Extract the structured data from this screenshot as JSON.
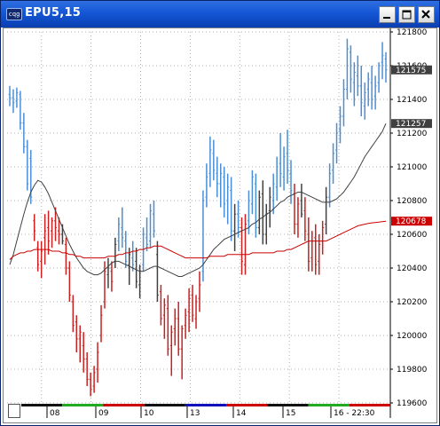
{
  "window": {
    "title": "EPU5,15",
    "app_icon_text": "cqg"
  },
  "chart_data": {
    "type": "bar",
    "subtype": "ohlc",
    "symbol": "EPU5",
    "interval_minutes": 15,
    "ylim": [
      119600,
      121800
    ],
    "y_tick_labels": [
      "121800",
      "121600",
      "121400",
      "121200",
      "121000",
      "120800",
      "120600",
      "120400",
      "120200",
      "120000",
      "119800",
      "119600"
    ],
    "x_tick_labels": [
      "08",
      "09",
      "10",
      "13",
      "14",
      "15",
      "16 - 22:30"
    ],
    "price_tags": [
      {
        "label": "121575",
        "value": 121575,
        "color": "#404040",
        "series": "last price"
      },
      {
        "label": "121257",
        "value": 121257,
        "color": "#404040",
        "series": "short moving average"
      },
      {
        "label": "120678",
        "value": 120678,
        "color": "#cc0000",
        "series": "long moving average"
      }
    ],
    "colors": {
      "up_trend": "#4a8fd6",
      "down_trend": "#cc2020",
      "neutral": "#404040",
      "short_ma": "#404040",
      "long_ma": "#cc0000"
    },
    "grid": true,
    "grid_style": "dotted",
    "session_bar_colors": [
      "#111111",
      "#22aa22",
      "#cc0000",
      "#111111",
      "#1111bb",
      "#cc0000",
      "#111111",
      "#22aa22",
      "#cc0000"
    ],
    "series": [
      {
        "name": "",
        "kind": "ohlc",
        "bars": [
          [
            121430,
            121480,
            121360,
            121410
          ],
          [
            121410,
            121460,
            121320,
            121380
          ],
          [
            121390,
            121470,
            121350,
            121440
          ],
          [
            121430,
            121450,
            121220,
            121260
          ],
          [
            121260,
            121320,
            121080,
            121120
          ],
          [
            121120,
            121160,
            120860,
            120900
          ],
          [
            121050,
            121100,
            120780,
            120820
          ],
          [
            120680,
            120720,
            120560,
            120620
          ],
          [
            120520,
            120560,
            120380,
            120420
          ],
          [
            120440,
            120560,
            120340,
            120500
          ],
          [
            120580,
            120720,
            120420,
            120620
          ],
          [
            120640,
            120740,
            120480,
            120560
          ],
          [
            120620,
            120700,
            120520,
            120680
          ],
          [
            120680,
            120760,
            120560,
            120640
          ],
          [
            120620,
            120700,
            120540,
            120600
          ],
          [
            120600,
            120660,
            120540,
            120560
          ],
          [
            120540,
            120580,
            120360,
            120400
          ],
          [
            120400,
            120440,
            120200,
            120240
          ],
          [
            120200,
            120240,
            120020,
            120060
          ],
          [
            120080,
            120120,
            119900,
            119980
          ],
          [
            119980,
            120060,
            119840,
            120020
          ],
          [
            119940,
            120020,
            119780,
            119860
          ],
          [
            119860,
            119900,
            119700,
            119740
          ],
          [
            119740,
            119780,
            119640,
            119680
          ],
          [
            119700,
            119820,
            119660,
            119780
          ],
          [
            119800,
            119960,
            119720,
            119900
          ],
          [
            120000,
            120180,
            119960,
            120120
          ],
          [
            120200,
            120440,
            120160,
            120380
          ],
          [
            120360,
            120460,
            120280,
            120400
          ],
          [
            120380,
            120440,
            120260,
            120320
          ],
          [
            120440,
            120580,
            120400,
            120540
          ],
          [
            120560,
            120700,
            120500,
            120660
          ],
          [
            120640,
            120760,
            120520,
            120580
          ],
          [
            120560,
            120620,
            120400,
            120440
          ],
          [
            120420,
            120520,
            120300,
            120480
          ],
          [
            120460,
            120560,
            120380,
            120420
          ],
          [
            120440,
            120520,
            120280,
            120320
          ],
          [
            120300,
            120420,
            120220,
            120380
          ],
          [
            120420,
            120640,
            120380,
            120600
          ],
          [
            120580,
            120700,
            120500,
            120540
          ],
          [
            120560,
            120780,
            120520,
            120740
          ],
          [
            120720,
            120800,
            120580,
            120620
          ],
          [
            120480,
            120560,
            120200,
            120240
          ],
          [
            120260,
            120300,
            120060,
            120100
          ],
          [
            120120,
            120220,
            119980,
            120180
          ],
          [
            120160,
            120240,
            119880,
            119920
          ],
          [
            119940,
            120060,
            119760,
            120020
          ],
          [
            120040,
            120160,
            119940,
            120100
          ],
          [
            120100,
            120200,
            119880,
            119920
          ],
          [
            119920,
            120060,
            119740,
            120040
          ],
          [
            120060,
            120160,
            119980,
            120120
          ],
          [
            120140,
            120280,
            120020,
            120220
          ],
          [
            120240,
            120300,
            120080,
            120120
          ],
          [
            120100,
            120240,
            120040,
            120200
          ],
          [
            120220,
            120380,
            120140,
            120300
          ],
          [
            120380,
            120860,
            120320,
            120800
          ],
          [
            120820,
            121020,
            120760,
            120940
          ],
          [
            120960,
            121180,
            120880,
            121100
          ],
          [
            121080,
            121160,
            120920,
            120980
          ],
          [
            120960,
            121060,
            120820,
            120900
          ],
          [
            120900,
            121020,
            120760,
            120960
          ],
          [
            120940,
            121000,
            120700,
            120780
          ],
          [
            120800,
            120960,
            120660,
            120880
          ],
          [
            120860,
            120940,
            120560,
            120620
          ],
          [
            120620,
            120780,
            120500,
            120720
          ],
          [
            120720,
            120800,
            120580,
            120640
          ],
          [
            120640,
            120700,
            120360,
            120440
          ],
          [
            120420,
            120720,
            120360,
            120660
          ],
          [
            120680,
            120860,
            120600,
            120800
          ],
          [
            120780,
            120980,
            120720,
            120940
          ],
          [
            120900,
            120960,
            120580,
            120640
          ],
          [
            120640,
            120860,
            120600,
            120820
          ],
          [
            120840,
            120920,
            120540,
            120600
          ],
          [
            120600,
            120780,
            120540,
            120720
          ],
          [
            120740,
            120880,
            120640,
            120820
          ],
          [
            120800,
            120960,
            120720,
            120900
          ],
          [
            120880,
            121060,
            120800,
            121000
          ],
          [
            121020,
            121200,
            120880,
            120960
          ],
          [
            120940,
            121120,
            120860,
            121060
          ],
          [
            121080,
            121220,
            120900,
            120980
          ],
          [
            120960,
            121040,
            120780,
            120860
          ],
          [
            120840,
            120900,
            120600,
            120660
          ],
          [
            120660,
            120820,
            120580,
            120780
          ],
          [
            120800,
            120900,
            120700,
            120720
          ],
          [
            120740,
            120820,
            120560,
            120620
          ],
          [
            120600,
            120700,
            120380,
            120440
          ],
          [
            120460,
            120620,
            120380,
            120560
          ],
          [
            120580,
            120660,
            120360,
            120420
          ],
          [
            120440,
            120600,
            120360,
            120540
          ],
          [
            120560,
            120680,
            120480,
            120640
          ],
          [
            120660,
            120880,
            120600,
            120820
          ],
          [
            120820,
            121020,
            120760,
            120960
          ],
          [
            120980,
            121140,
            120900,
            121080
          ],
          [
            121100,
            121260,
            121020,
            121200
          ],
          [
            121220,
            121360,
            121140,
            121300
          ],
          [
            121300,
            121520,
            121240,
            121460
          ],
          [
            121460,
            121760,
            121400,
            121700
          ],
          [
            121680,
            121720,
            121440,
            121520
          ],
          [
            121500,
            121620,
            121360,
            121560
          ],
          [
            121540,
            121660,
            121420,
            121480
          ],
          [
            121480,
            121600,
            121300,
            121380
          ],
          [
            121360,
            121500,
            121280,
            121440
          ],
          [
            121460,
            121560,
            121360,
            121520
          ],
          [
            121500,
            121600,
            121340,
            121400
          ],
          [
            121420,
            121540,
            121340,
            121480
          ],
          [
            121500,
            121620,
            121440,
            121600
          ],
          [
            121620,
            121740,
            121520,
            121660
          ],
          [
            121640,
            121680,
            121500,
            121575
          ]
        ]
      },
      {
        "name": "",
        "kind": "line",
        "values": [
          120420,
          120480,
          120560,
          120640,
          120720,
          120790,
          120850,
          120890,
          120920,
          120910,
          120880,
          120840,
          120790,
          120740,
          120690,
          120640,
          120590,
          120540,
          120500,
          120460,
          120430,
          120400,
          120380,
          120370,
          120360,
          120360,
          120370,
          120390,
          120410,
          120430,
          120440,
          120440,
          120430,
          120420,
          120410,
          120400,
          120390,
          120380,
          120380,
          120390,
          120400,
          120410,
          120410,
          120400,
          120390,
          120380,
          120370,
          120360,
          120350,
          120350,
          120360,
          120370,
          120380,
          120390,
          120400,
          120420,
          120450,
          120480,
          120510,
          120530,
          120550,
          120570,
          120580,
          120590,
          120600,
          120610,
          120620,
          120630,
          120640,
          120660,
          120670,
          120690,
          120700,
          120720,
          120730,
          120750,
          120770,
          120790,
          120800,
          120820,
          120830,
          120840,
          120850,
          120850,
          120840,
          120830,
          120820,
          120810,
          120800,
          120790,
          120790,
          120790,
          120800,
          120810,
          120830,
          120850,
          120880,
          120910,
          120940,
          120980,
          121020,
          121060,
          121090,
          121120,
          121150,
          121180,
          121210,
          121257
        ]
      },
      {
        "name": "",
        "kind": "line",
        "values": [
          120450,
          120470,
          120480,
          120490,
          120490,
          120500,
          120500,
          120510,
          120510,
          120510,
          120510,
          120510,
          120500,
          120500,
          120500,
          120490,
          120490,
          120480,
          120480,
          120470,
          120470,
          120460,
          120460,
          120460,
          120460,
          120460,
          120460,
          120460,
          120470,
          120470,
          120470,
          120480,
          120480,
          120490,
          120490,
          120500,
          120500,
          120510,
          120510,
          120520,
          120520,
          120530,
          120530,
          120530,
          120520,
          120510,
          120500,
          120490,
          120480,
          120470,
          120460,
          120460,
          120460,
          120460,
          120460,
          120460,
          120460,
          120470,
          120470,
          120470,
          120470,
          120470,
          120480,
          120480,
          120480,
          120480,
          120480,
          120480,
          120480,
          120490,
          120490,
          120490,
          120490,
          120490,
          120490,
          120490,
          120500,
          120500,
          120500,
          120510,
          120510,
          120520,
          120530,
          120540,
          120550,
          120560,
          120560,
          120560,
          120560,
          120560,
          120560,
          120570,
          120580,
          120590,
          120600,
          120610,
          120620,
          120630,
          120640,
          120650,
          120655,
          120660,
          120665,
          120668,
          120670,
          120672,
          120675,
          120678
        ]
      }
    ]
  }
}
